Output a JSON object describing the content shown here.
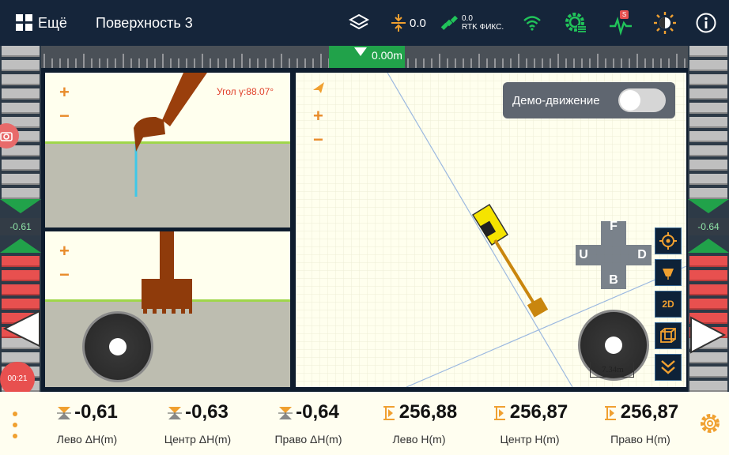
{
  "topbar": {
    "menu_label": "Ещё",
    "surface_title": "Поверхность 3",
    "height_offset": "0.0",
    "rtk_value": "0.0",
    "rtk_status": "RTK ФИКС.",
    "signal_badge": "S"
  },
  "ruler": {
    "value": "0.00m"
  },
  "left_scale": {
    "readout": "-0.61",
    "timer": "00:21"
  },
  "right_scale": {
    "readout": "-0.64"
  },
  "side_view": {
    "angle_label": "Угол γ:88.07°",
    "zoom_in": "+",
    "zoom_out": "−"
  },
  "front_view": {
    "zoom_in": "+",
    "zoom_out": "−"
  },
  "map": {
    "zoom_in": "+",
    "zoom_out": "−",
    "demo_label": "Демо-движение",
    "demo_enabled": false,
    "dpad": {
      "up": "F",
      "down": "B",
      "left": "U",
      "right": "D"
    },
    "tool_2d": "2D",
    "scale_label": "7.34m"
  },
  "readings": [
    {
      "value": "-0,61",
      "label": "Лево ΔH(m)",
      "icon": "delta-height-icon"
    },
    {
      "value": "-0,63",
      "label": "Центр ΔH(m)",
      "icon": "delta-height-icon"
    },
    {
      "value": "-0,64",
      "label": "Право ΔH(m)",
      "icon": "delta-height-icon"
    },
    {
      "value": "256,88",
      "label": "Лево H(m)",
      "icon": "height-icon"
    },
    {
      "value": "256,87",
      "label": "Центр H(m)",
      "icon": "height-icon"
    },
    {
      "value": "256,87",
      "label": "Право H(m)",
      "icon": "height-icon"
    }
  ],
  "colors": {
    "accent": "#e88b2a",
    "green": "#21a24a",
    "red": "#e8504f",
    "topbar": "#15253a"
  }
}
